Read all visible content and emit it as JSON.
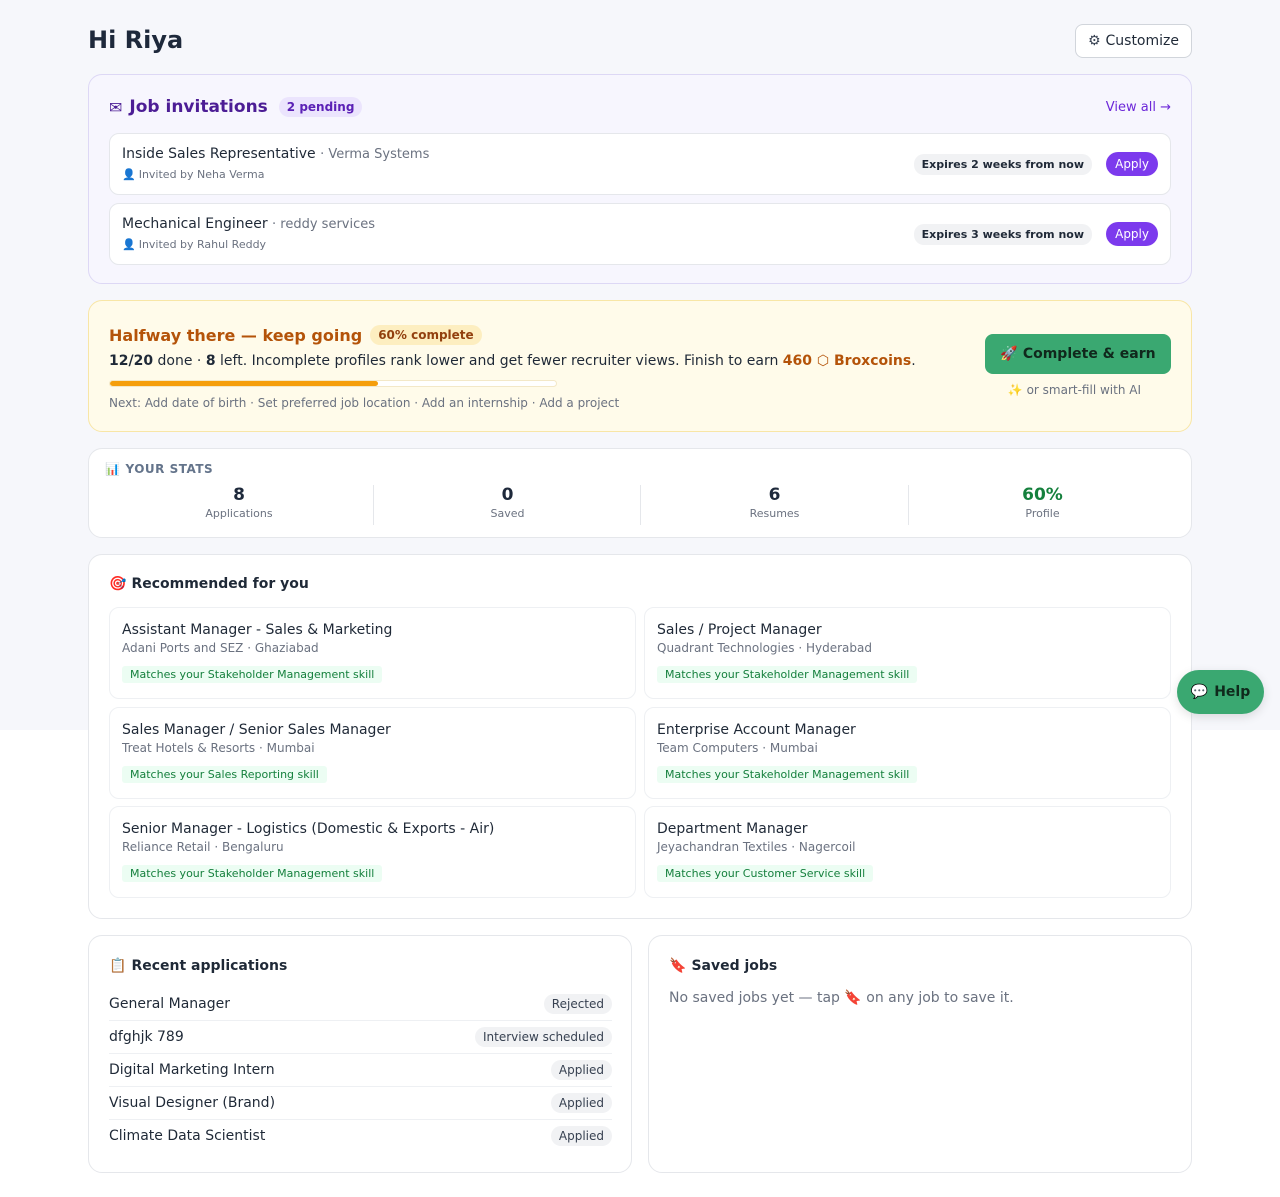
{
  "header": {
    "greeting": "Hi Riya",
    "greeting_emoji": "",
    "customize_icon": "gear-icon",
    "customize_label": "Customize"
  },
  "invitations": {
    "icon": "envelope-icon",
    "title": "Job invitations",
    "pending": "2 pending",
    "view_all": "View all →",
    "items": [
      {
        "role": "Inside Sales Representative",
        "company": "· Verma Systems",
        "invited": "Invited by Neha Verma",
        "expires": "Expires 2 weeks from now",
        "apply": "Apply"
      },
      {
        "role": "Mechanical Engineer",
        "company": "· reddy services",
        "invited": "Invited by Rahul Reddy",
        "expires": "Expires 3 weeks from now",
        "apply": "Apply"
      }
    ]
  },
  "progress": {
    "title": "Halfway there — keep going",
    "badge": "60% complete",
    "done": "12/20",
    "done_suffix": " done · ",
    "left": "8",
    "left_suffix": " left. Incomplete profiles rank lower and get fewer recruiter views. Finish to earn ",
    "coins": "460 ⬡ Broxcoins",
    "coins_suffix": ".",
    "fraction": 0.6,
    "next": "Next: Add date of birth · Set preferred job location · Add an internship · Add a project",
    "cta": "Complete & earn",
    "smartfill": "or smart-fill with AI"
  },
  "stats": {
    "label": "YOUR STATS",
    "items": [
      {
        "value": "8",
        "label": "Applications",
        "color": "#1e293b"
      },
      {
        "value": "0",
        "label": "Saved",
        "color": "#1e293b"
      },
      {
        "value": "6",
        "label": "Resumes",
        "color": "#1e293b"
      },
      {
        "value": "60%",
        "label": "Profile",
        "color": "#15803d"
      }
    ]
  },
  "recommended": {
    "title": "Recommended for you",
    "items": [
      {
        "title": "Assistant Manager - Sales & Marketing",
        "sub": "Adani Ports and SEZ · Ghaziabad",
        "match": "Matches your Stakeholder Management skill"
      },
      {
        "title": "Sales / Project Manager",
        "sub": "Quadrant Technologies · Hyderabad",
        "match": "Matches your Stakeholder Management skill"
      },
      {
        "title": "Sales Manager / Senior Sales Manager",
        "sub": "Treat Hotels & Resorts · Mumbai",
        "match": "Matches your Sales Reporting skill"
      },
      {
        "title": "Enterprise Account Manager",
        "sub": "Team Computers · Mumbai",
        "match": "Matches your Stakeholder Management skill"
      },
      {
        "title": "Senior Manager - Logistics (Domestic & Exports - Air)",
        "sub": "Reliance Retail · Bengaluru",
        "match": "Matches your Stakeholder Management skill"
      },
      {
        "title": "Department Manager",
        "sub": "Jeyachandran Textiles · Nagercoil",
        "match": "Matches your Customer Service skill"
      }
    ]
  },
  "help": {
    "label": "Help"
  },
  "recent": {
    "title": "Recent applications",
    "items": [
      {
        "name": "General Manager",
        "status": "Rejected"
      },
      {
        "name": "dfghjk 789",
        "status": "Interview scheduled"
      },
      {
        "name": "Digital Marketing Intern",
        "status": "Applied"
      },
      {
        "name": "Visual Designer (Brand)",
        "status": "Applied"
      },
      {
        "name": "Climate Data Scientist",
        "status": "Applied"
      }
    ]
  },
  "saved": {
    "title": "Saved jobs",
    "empty_prefix": "No saved jobs yet — tap ",
    "empty_suffix": " on any job to save it."
  }
}
